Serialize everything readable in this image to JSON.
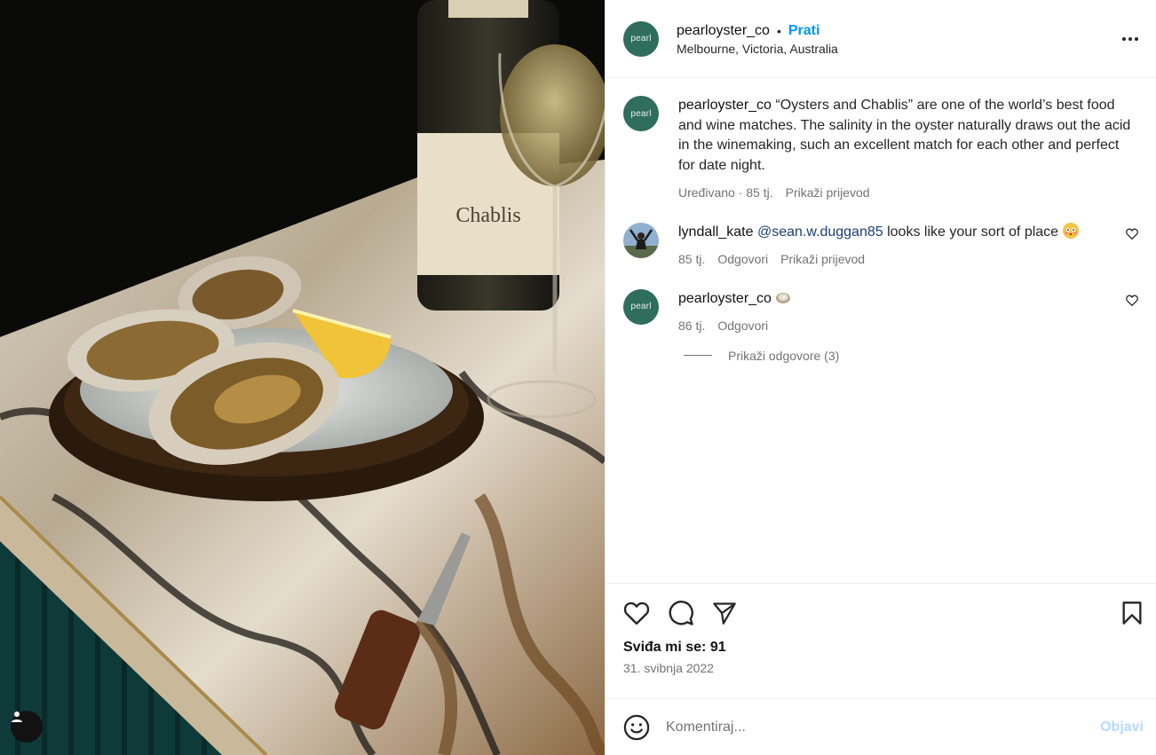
{
  "post": {
    "username": "pearloyster_co",
    "follow_label": "Prati",
    "location": "Melbourne, Victoria, Australia",
    "avatar_text": "pearl",
    "photo_label": "Chablis"
  },
  "caption": {
    "username": "pearloyster_co",
    "text": "“Oysters and Chablis” are one of the world’s best food and wine matches. The salinity in the oyster naturally draws out the acid in the winemaking, such an excellent match for each other and perfect for date night.",
    "meta_time": "Uređivano · 85 tj.",
    "translate": "Prikaži prijevod"
  },
  "comments": [
    {
      "username": "lyndall_kate",
      "mention": "@sean.w.duggan85",
      "text": " looks like your sort of place",
      "time": "85 tj.",
      "reply": "Odgovori",
      "translate": "Prikaži prijevod",
      "emoji": "flushed-face"
    },
    {
      "username": "pearloyster_co",
      "time": "86 tj.",
      "reply": "Odgovori",
      "emoji": "oyster"
    }
  ],
  "view_replies": "Prikaži odgovore (3)",
  "likes": "Sviđa mi se: 91",
  "date": "31. svibnja 2022",
  "add_comment": {
    "placeholder": "Komentiraj...",
    "post_label": "Objavi"
  },
  "colors": {
    "accent": "#0095f6",
    "avatar_bg": "#2f6d5d",
    "mention": "#1b3f74",
    "post_disabled": "#b3dbff"
  },
  "icons": [
    "user-tag-icon",
    "more-icon",
    "heart-icon",
    "comment-icon",
    "share-icon",
    "bookmark-icon",
    "emoji-icon"
  ]
}
